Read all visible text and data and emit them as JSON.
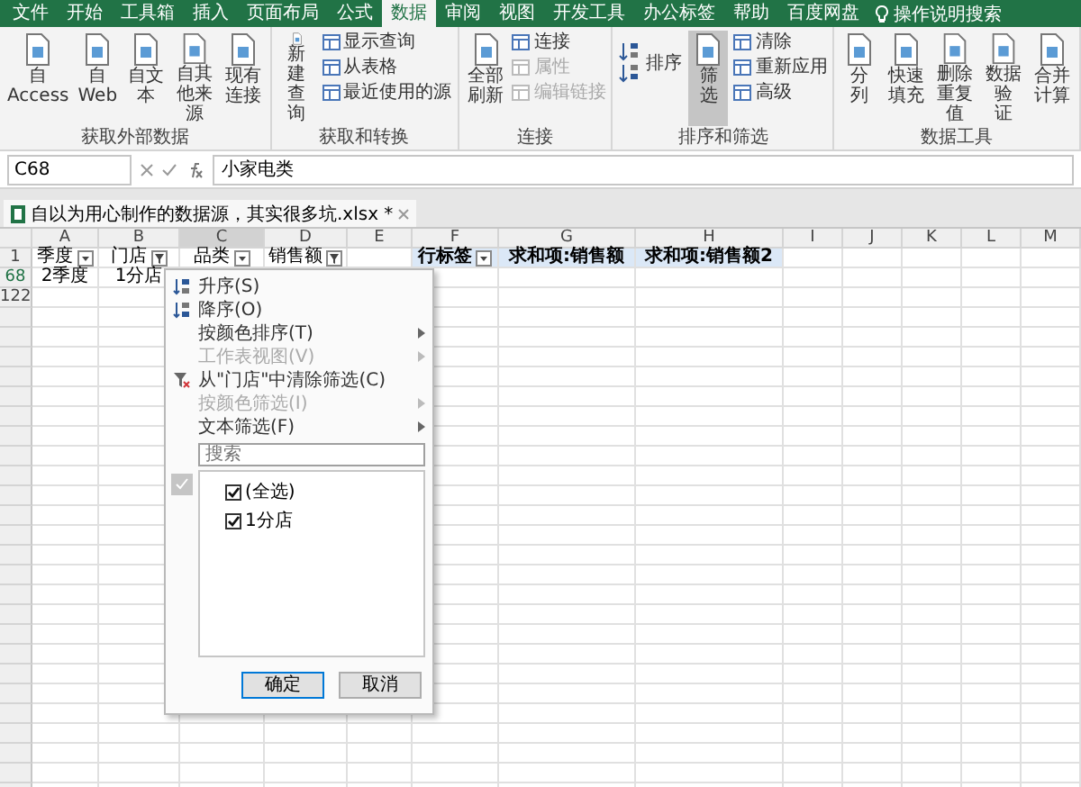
{
  "menu_tabs": [
    {
      "label": "文件",
      "selected": false
    },
    {
      "label": "开始",
      "selected": false
    },
    {
      "label": "工具箱",
      "selected": false
    },
    {
      "label": "插入",
      "selected": false
    },
    {
      "label": "页面布局",
      "selected": false
    },
    {
      "label": "公式",
      "selected": false
    },
    {
      "label": "数据",
      "selected": true
    },
    {
      "label": "审阅",
      "selected": false
    },
    {
      "label": "视图",
      "selected": false
    },
    {
      "label": "开发工具",
      "selected": false
    },
    {
      "label": "办公标签",
      "selected": false
    },
    {
      "label": "帮助",
      "selected": false
    },
    {
      "label": "百度网盘",
      "selected": false
    }
  ],
  "tell_me": "操作说明搜索",
  "ribbon": [
    {
      "label": "获取外部数据",
      "items": [
        {
          "kind": "large",
          "lines": [
            "自 Access"
          ],
          "selected": false,
          "disabled": false
        },
        {
          "kind": "large",
          "lines": [
            "自",
            "Web"
          ],
          "selected": false,
          "disabled": false
        },
        {
          "kind": "large",
          "lines": [
            "自文本"
          ],
          "selected": false,
          "disabled": false
        },
        {
          "kind": "large",
          "lines": [
            "自其他来源"
          ],
          "selected": false,
          "disabled": false
        },
        {
          "kind": "large",
          "lines": [
            "现有连接"
          ],
          "selected": false,
          "disabled": false
        }
      ]
    },
    {
      "label": "获取和转换",
      "items": [
        {
          "kind": "large",
          "lines": [
            "新建",
            "查询"
          ],
          "selected": false,
          "disabled": false
        },
        {
          "kind": "stack",
          "entries": [
            {
              "label": "显示查询",
              "disabled": false
            },
            {
              "label": "从表格",
              "disabled": false
            },
            {
              "label": "最近使用的源",
              "disabled": false
            }
          ]
        }
      ]
    },
    {
      "label": "连接",
      "items": [
        {
          "kind": "large",
          "lines": [
            "全部刷新"
          ],
          "selected": false,
          "disabled": false
        },
        {
          "kind": "stack",
          "entries": [
            {
              "label": "连接",
              "disabled": false
            },
            {
              "label": "属性",
              "disabled": true
            },
            {
              "label": "编辑链接",
              "disabled": true
            }
          ]
        }
      ]
    },
    {
      "label": "排序和筛选",
      "items": [
        {
          "kind": "sort",
          "lines": [
            "排序"
          ],
          "selected": false,
          "disabled": false
        },
        {
          "kind": "large",
          "lines": [
            "筛选"
          ],
          "selected": true,
          "disabled": false
        },
        {
          "kind": "stack",
          "entries": [
            {
              "label": "清除",
              "disabled": false
            },
            {
              "label": "重新应用",
              "disabled": false
            },
            {
              "label": "高级",
              "disabled": false
            }
          ]
        }
      ]
    },
    {
      "label": "数据工具",
      "items": [
        {
          "kind": "large",
          "lines": [
            "分列"
          ],
          "selected": false,
          "disabled": false
        },
        {
          "kind": "large",
          "lines": [
            "快速填充"
          ],
          "selected": false,
          "disabled": false
        },
        {
          "kind": "large",
          "lines": [
            "删除",
            "重复值"
          ],
          "selected": false,
          "disabled": false
        },
        {
          "kind": "large",
          "lines": [
            "数据验",
            "证"
          ],
          "selected": false,
          "disabled": false
        },
        {
          "kind": "large",
          "lines": [
            "合并计算"
          ],
          "selected": false,
          "disabled": false
        }
      ]
    }
  ],
  "name_box": "C68",
  "formula": "小家电类",
  "workbook_tab": "自以为用心制作的数据源，其实很多坑.xlsx *",
  "columns": [
    "A",
    "B",
    "C",
    "D",
    "E",
    "F",
    "G",
    "H",
    "I",
    "J",
    "K",
    "L",
    "M"
  ],
  "rows": [
    {
      "number": "1",
      "cells": [
        {
          "text": "季度",
          "kind": "dropdown",
          "pivot": false
        },
        {
          "text": "门店",
          "kind": "filtered",
          "pivot": false
        },
        {
          "text": "品类",
          "kind": "dropdown",
          "pivot": false
        },
        {
          "text": "销售额",
          "kind": "filtered",
          "pivot": false
        },
        {
          "text": "",
          "kind": "plain",
          "pivot": false
        },
        {
          "text": "行标签",
          "kind": "dropdown",
          "pivot": true
        },
        {
          "text": "求和项:销售额",
          "kind": "plain",
          "pivot": true
        },
        {
          "text": "求和项:销售额2",
          "kind": "plain",
          "pivot": true
        }
      ]
    },
    {
      "number": "68",
      "cells": [
        {
          "text": "2季度",
          "kind": "plain",
          "pivot": false
        },
        {
          "text": "1分店",
          "kind": "plain",
          "pivot": false
        }
      ]
    },
    {
      "number": "122",
      "cells": []
    }
  ],
  "filter_menu": {
    "items": [
      {
        "label": "升序(S)",
        "kind": "sort-asc",
        "disabled": false,
        "submenu": false
      },
      {
        "label": "降序(O)",
        "kind": "sort-desc",
        "disabled": false,
        "submenu": false
      },
      {
        "label": "按颜色排序(T)",
        "kind": "plain",
        "disabled": false,
        "submenu": true
      },
      {
        "label": "工作表视图(V)",
        "kind": "plain",
        "disabled": true,
        "submenu": true
      },
      {
        "label": "从\"门店\"中清除筛选(C)",
        "kind": "clear-filter",
        "disabled": false,
        "submenu": false
      },
      {
        "label": "按颜色筛选(I)",
        "kind": "plain",
        "disabled": true,
        "submenu": true
      },
      {
        "label": "文本筛选(F)",
        "kind": "plain",
        "disabled": false,
        "submenu": true
      }
    ],
    "search": {
      "placeholder": "搜索"
    },
    "values": [
      {
        "label": "(全选)",
        "checked": true
      },
      {
        "label": "1分店",
        "checked": true
      }
    ],
    "buttons": [
      "确定",
      "取消"
    ]
  }
}
